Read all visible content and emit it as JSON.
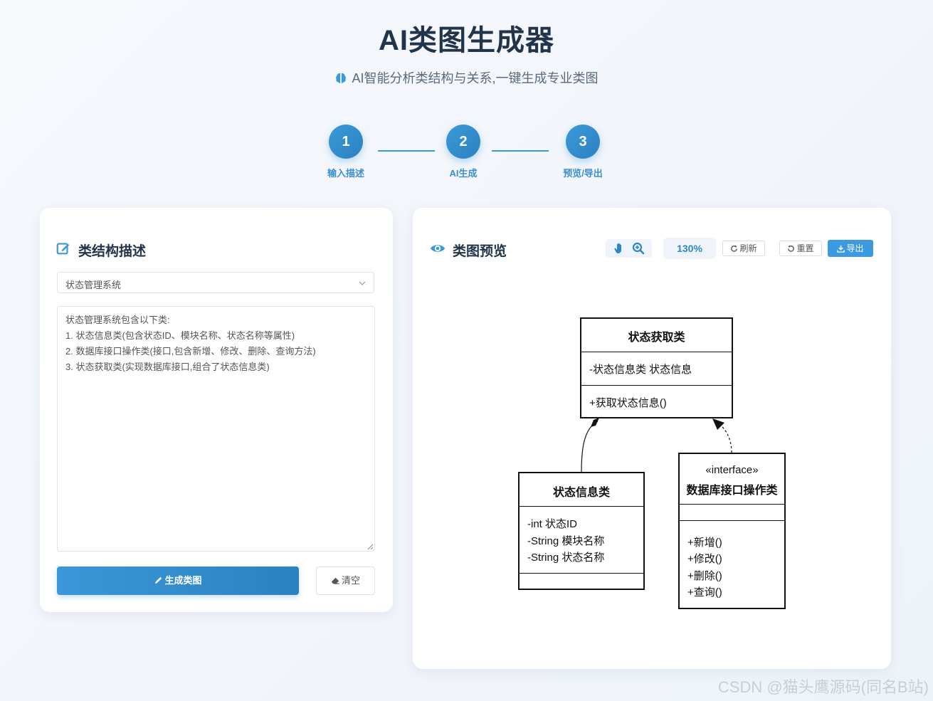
{
  "header": {
    "title": "AI类图生成器",
    "subtitle": "AI智能分析类结构与关系,一键生成专业类图"
  },
  "steps": [
    {
      "number": "1",
      "label": "输入描述"
    },
    {
      "number": "2",
      "label": "AI生成"
    },
    {
      "number": "3",
      "label": "预览/导出"
    }
  ],
  "left_panel": {
    "title": "类结构描述",
    "select_value": "状态管理系统",
    "textarea_lines": [
      "状态管理系统包含以下类:",
      "1. 状态信息类(包含状态ID、模块名称、状态名称等属性)",
      "2. 数据库接口操作类(接口,包含新增、修改、删除、查询方法)",
      "3. 状态获取类(实现数据库接口,组合了状态信息类)"
    ],
    "generate_button": "生成类图",
    "clear_button": "清空"
  },
  "right_panel": {
    "title": "类图预览",
    "zoom": "130%",
    "refresh_button": "刷新",
    "reset_button": "重置",
    "export_button": "导出"
  },
  "diagram": {
    "class_getter": {
      "name": "状态获取类",
      "attributes": [
        "-状态信息类 状态信息"
      ],
      "methods": [
        "+获取状态信息()"
      ]
    },
    "class_info": {
      "name": "状态信息类",
      "attributes": [
        "-int 状态ID",
        "-String 模块名称",
        "-String 状态名称"
      ],
      "methods": []
    },
    "class_db": {
      "stereotype": "«interface»",
      "name": "数据库接口操作类",
      "attributes": [],
      "methods": [
        "+新增()",
        "+修改()",
        "+删除()",
        "+查询()"
      ]
    }
  },
  "watermark": "CSDN @猫头鹰源码(同名B站)",
  "colors": {
    "accent": "#3498db",
    "title": "#22344a",
    "background": "#f6f8fc"
  }
}
